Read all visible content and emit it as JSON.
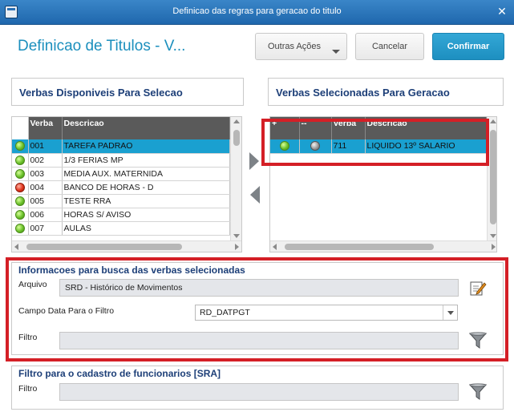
{
  "window": {
    "title": "Definicao das regras para geracao do titulo"
  },
  "header": {
    "page_title": "Definicao de Titulos - V...",
    "outras_acoes": "Outras Ações",
    "cancelar": "Cancelar",
    "confirmar": "Confirmar"
  },
  "left_panel": {
    "title": "Verbas Disponiveis Para Selecao",
    "columns": [
      "Verba",
      "Descricao"
    ],
    "rows": [
      {
        "status": "green",
        "verba": "001",
        "descricao": "TAREFA PADRAO",
        "selected": true
      },
      {
        "status": "green",
        "verba": "002",
        "descricao": "1/3 FERIAS MP"
      },
      {
        "status": "green",
        "verba": "003",
        "descricao": "MEDIA AUX. MATERNIDA"
      },
      {
        "status": "red",
        "verba": "004",
        "descricao": "BANCO DE HORAS - D"
      },
      {
        "status": "green",
        "verba": "005",
        "descricao": "TESTE RRA"
      },
      {
        "status": "green",
        "verba": "006",
        "descricao": "HORAS S/ AVISO"
      },
      {
        "status": "green",
        "verba": "007",
        "descricao": "AULAS"
      }
    ]
  },
  "right_panel": {
    "title": "Verbas Selecionadas Para Geracao",
    "columns": [
      "+",
      "--",
      "Verba",
      "Descricao"
    ],
    "rows": [
      {
        "status1": "green",
        "status2": "gray",
        "verba": "711",
        "descricao": "LIQUIDO 13º SALARIO",
        "selected": true
      }
    ]
  },
  "busca": {
    "title": "Informacoes para busca das verbas selecionadas",
    "arquivo_label": "Arquivo",
    "arquivo_value": "SRD - Histórico de Movimentos",
    "campo_data_label": "Campo Data Para o Filtro",
    "campo_data_value": "RD_DATPGT",
    "filtro_label": "Filtro",
    "filtro_value": ""
  },
  "cadastro": {
    "title": "Filtro para o cadastro de funcionarios [SRA]",
    "filtro_label": "Filtro",
    "filtro_value": ""
  },
  "colors": {
    "accent": "#1b8fbd",
    "confirm": "#1d8fc0",
    "selection": "#1aa0d0",
    "highlight_box": "#d41f26"
  }
}
